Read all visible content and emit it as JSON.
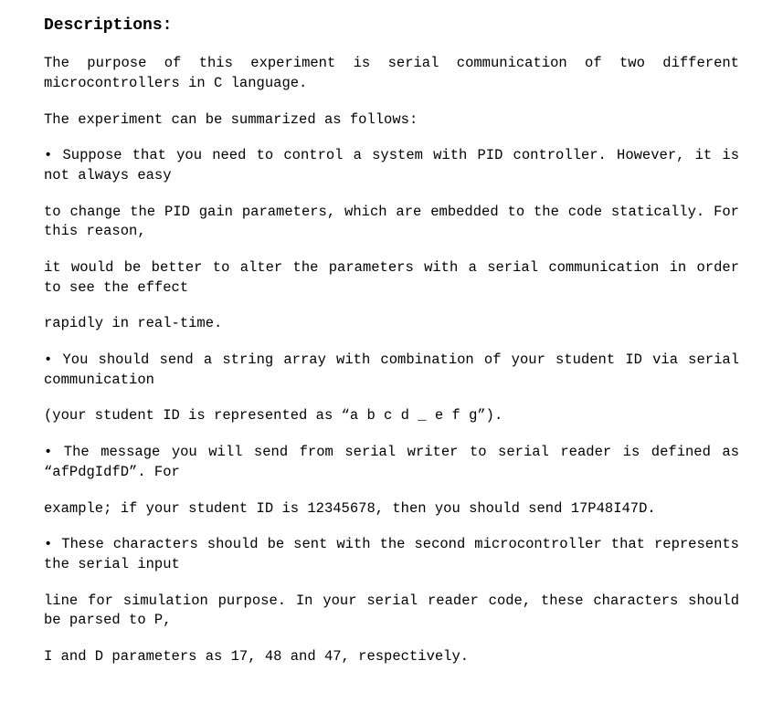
{
  "heading": "Descriptions:",
  "paragraphs": [
    "The purpose of this experiment is serial communication of two different microcontrollers in C language.",
    "The experiment can be summarized as follows:",
    "• Suppose that you need to control a system with PID controller. However, it is not always easy",
    "to change the PID gain parameters, which are embedded to the code statically. For this reason,",
    "it would be better to alter the parameters with a serial communication in order to see the effect",
    "rapidly in real-time.",
    "• You should send a string array with combination of your student ID via serial communication",
    "(your student ID is represented as “a b c d _ e f g”).",
    "• The message you will send from serial writer to serial reader is defined as “afPdgIdfD”. For",
    "example; if your student ID is 12345678, then you should send 17P48I47D.",
    "• These characters should be sent with the second microcontroller that represents the serial input",
    "line for simulation purpose. In your serial reader code, these characters should be parsed to P,",
    "I and D parameters as 17, 48 and 47, respectively."
  ],
  "no_justify_indices": [
    1,
    5,
    7
  ]
}
